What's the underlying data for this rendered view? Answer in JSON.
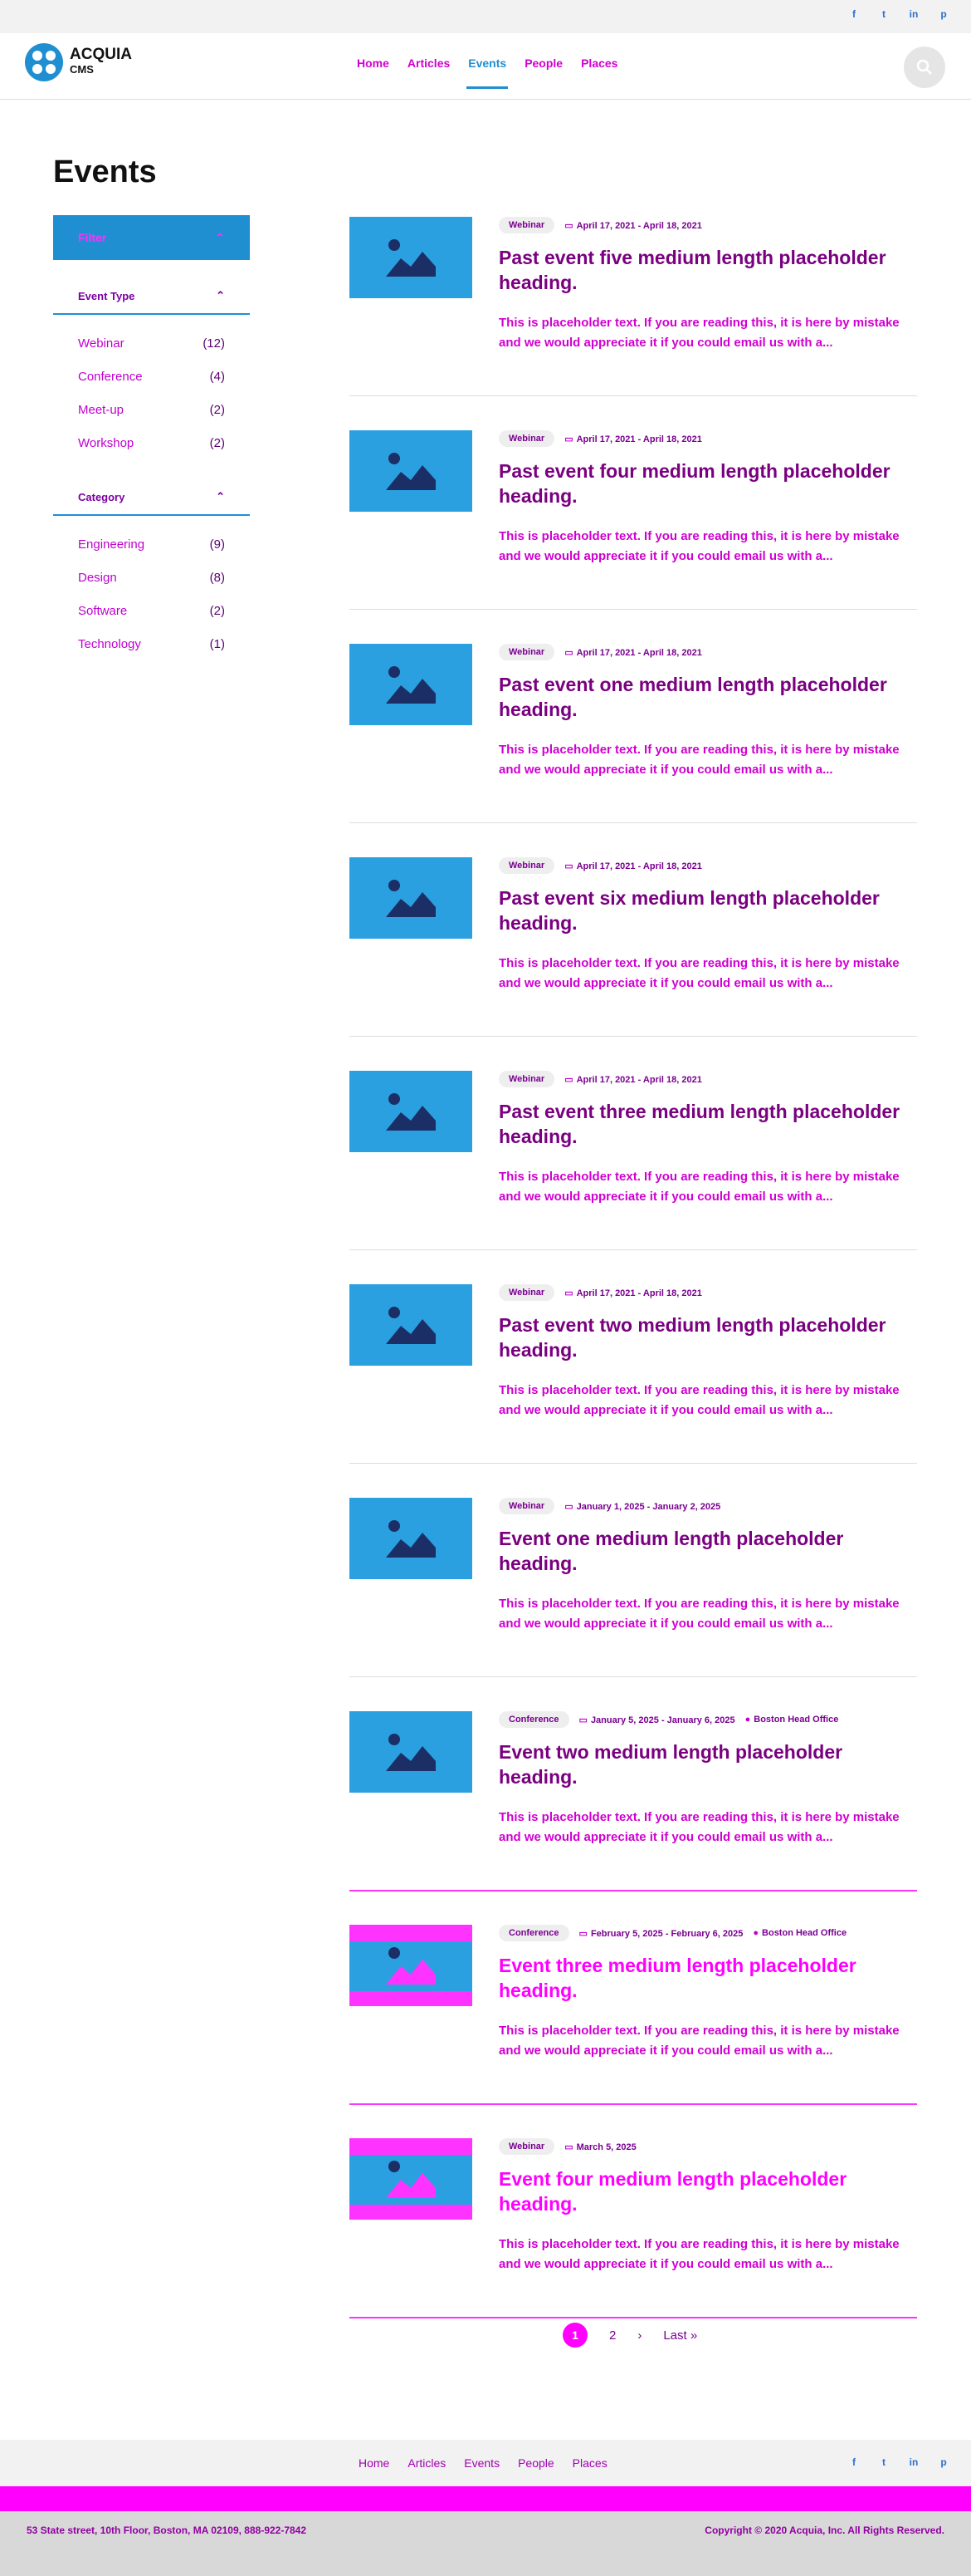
{
  "header": {
    "logo_line1": "ACQUIA",
    "logo_line2": "CMS",
    "nav": [
      "Home",
      "Articles",
      "Events",
      "People",
      "Places"
    ],
    "active_nav": "Events",
    "social_icons": [
      "facebook-icon",
      "twitter-icon",
      "linkedin-icon",
      "pinterest-icon"
    ]
  },
  "page_title": "Events",
  "filters": {
    "label": "Filter",
    "event_type": {
      "title": "Event Type",
      "items": [
        {
          "label": "Webinar",
          "count": "(12)"
        },
        {
          "label": "Conference",
          "count": "(4)"
        },
        {
          "label": "Meet-up",
          "count": "(2)"
        },
        {
          "label": "Workshop",
          "count": "(2)"
        }
      ]
    },
    "category": {
      "title": "Category",
      "items": [
        {
          "label": "Engineering",
          "count": "(9)"
        },
        {
          "label": "Design",
          "count": "(8)"
        },
        {
          "label": "Software",
          "count": "(2)"
        },
        {
          "label": "Technology",
          "count": "(1)"
        }
      ]
    }
  },
  "events": [
    {
      "type": "Webinar",
      "date": "April 17, 2021 - April 18, 2021",
      "location": "",
      "title": "Past event five medium length placeholder heading.",
      "summary": "This is placeholder text. If you are reading this, it is here by mistake and we would appreciate it if you could email us with a..."
    },
    {
      "type": "Webinar",
      "date": "April 17, 2021 - April 18, 2021",
      "location": "",
      "title": "Past event four medium length placeholder heading.",
      "summary": "This is placeholder text. If you are reading this, it is here by mistake and we would appreciate it if you could email us with a..."
    },
    {
      "type": "Webinar",
      "date": "April 17, 2021 - April 18, 2021",
      "location": "",
      "title": "Past event one medium length placeholder heading.",
      "summary": "This is placeholder text. If you are reading this, it is here by mistake and we would appreciate it if you could email us with a..."
    },
    {
      "type": "Webinar",
      "date": "April 17, 2021 - April 18, 2021",
      "location": "",
      "title": "Past event six medium length placeholder heading.",
      "summary": "This is placeholder text. If you are reading this, it is here by mistake and we would appreciate it if you could email us with a..."
    },
    {
      "type": "Webinar",
      "date": "April 17, 2021 - April 18, 2021",
      "location": "",
      "title": "Past event three medium length placeholder heading.",
      "summary": "This is placeholder text. If you are reading this, it is here by mistake and we would appreciate it if you could email us with a..."
    },
    {
      "type": "Webinar",
      "date": "April 17, 2021 - April 18, 2021",
      "location": "",
      "title": "Past event two medium length placeholder heading.",
      "summary": "This is placeholder text. If you are reading this, it is here by mistake and we would appreciate it if you could email us with a..."
    },
    {
      "type": "Webinar",
      "date": "January 1, 2025 - January 2, 2025",
      "location": "",
      "title": "Event one medium length placeholder heading.",
      "summary": "This is placeholder text. If you are reading this, it is here by mistake and we would appreciate it if you could email us with a..."
    },
    {
      "type": "Conference",
      "date": "January 5, 2025 - January 6, 2025",
      "location": "Boston Head Office",
      "title": "Event two medium length placeholder heading.",
      "summary": "This is placeholder text. If you are reading this, it is here by mistake and we would appreciate it if you could email us with a..."
    },
    {
      "type": "Conference",
      "date": "February 5, 2025 - February 6, 2025",
      "location": "Boston Head Office",
      "title": "Event three medium length placeholder heading.",
      "summary": "This is placeholder text. If you are reading this, it is here by mistake and we would appreciate it if you could email us with a..."
    },
    {
      "type": "Webinar",
      "date": "March 5, 2025",
      "location": "",
      "title": "Event four medium length placeholder heading.",
      "summary": "This is placeholder text. If you are reading this, it is here by mistake and we would appreciate it if you could email us with a..."
    }
  ],
  "pager": {
    "current": "1",
    "next_page": "2",
    "next": "›",
    "last": "Last »"
  },
  "footer": {
    "nav": [
      "Home",
      "Articles",
      "Events",
      "People",
      "Places"
    ],
    "address": "53 State street, 10th Floor, Boston, MA 02109, 888-922-7842",
    "copyright": "Copyright © 2020 Acquia, Inc. All Rights Reserved."
  }
}
